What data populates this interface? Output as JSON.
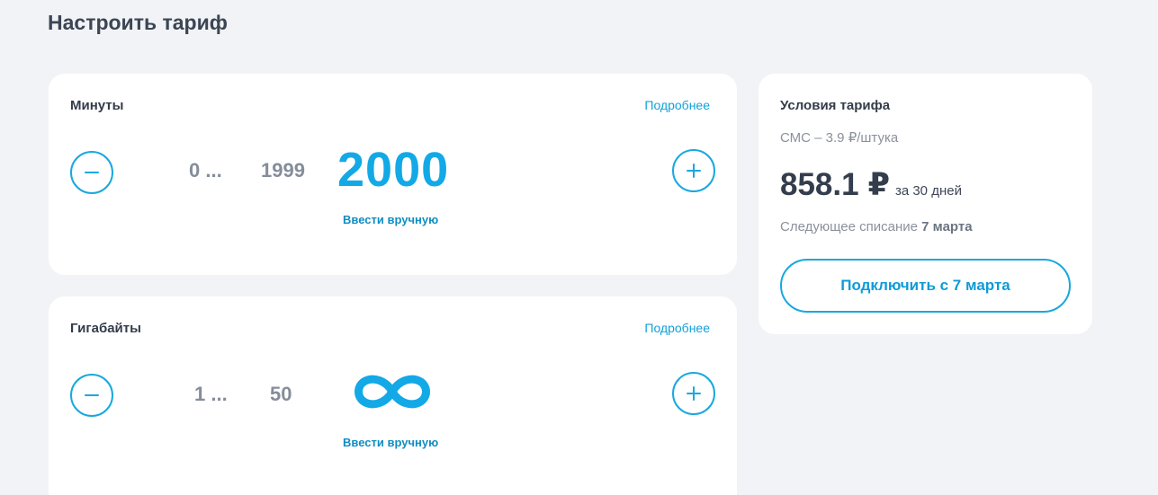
{
  "page": {
    "title": "Настроить тариф"
  },
  "minutes": {
    "title": "Минуты",
    "more_link": "Подробнее",
    "value_first": "0 ...",
    "value_prev": "1999",
    "value_selected": "2000",
    "manual_entry": "Ввести вручную",
    "decrease_icon": "minus-icon",
    "increase_icon": "plus-icon"
  },
  "gigabytes": {
    "title": "Гигабайты",
    "more_link": "Подробнее",
    "value_first": "1 ...",
    "value_prev": "50",
    "value_selected_icon": "infinity-icon",
    "manual_entry": "Ввести вручную",
    "decrease_icon": "minus-icon",
    "increase_icon": "plus-icon"
  },
  "tariff": {
    "title": "Условия тарифа",
    "sms": "СМС – 3.9 ₽/штука",
    "price": "858.1",
    "currency": "₽",
    "period": "за 30 дней",
    "next_charge_label": "Следующее списание",
    "next_charge_date": "7 марта",
    "connect_button": "Подключить с 7 марта"
  },
  "colors": {
    "accent": "#12a9e6",
    "background": "#f2f3f6",
    "card": "#ffffff",
    "muted_text": "#858d9a"
  }
}
